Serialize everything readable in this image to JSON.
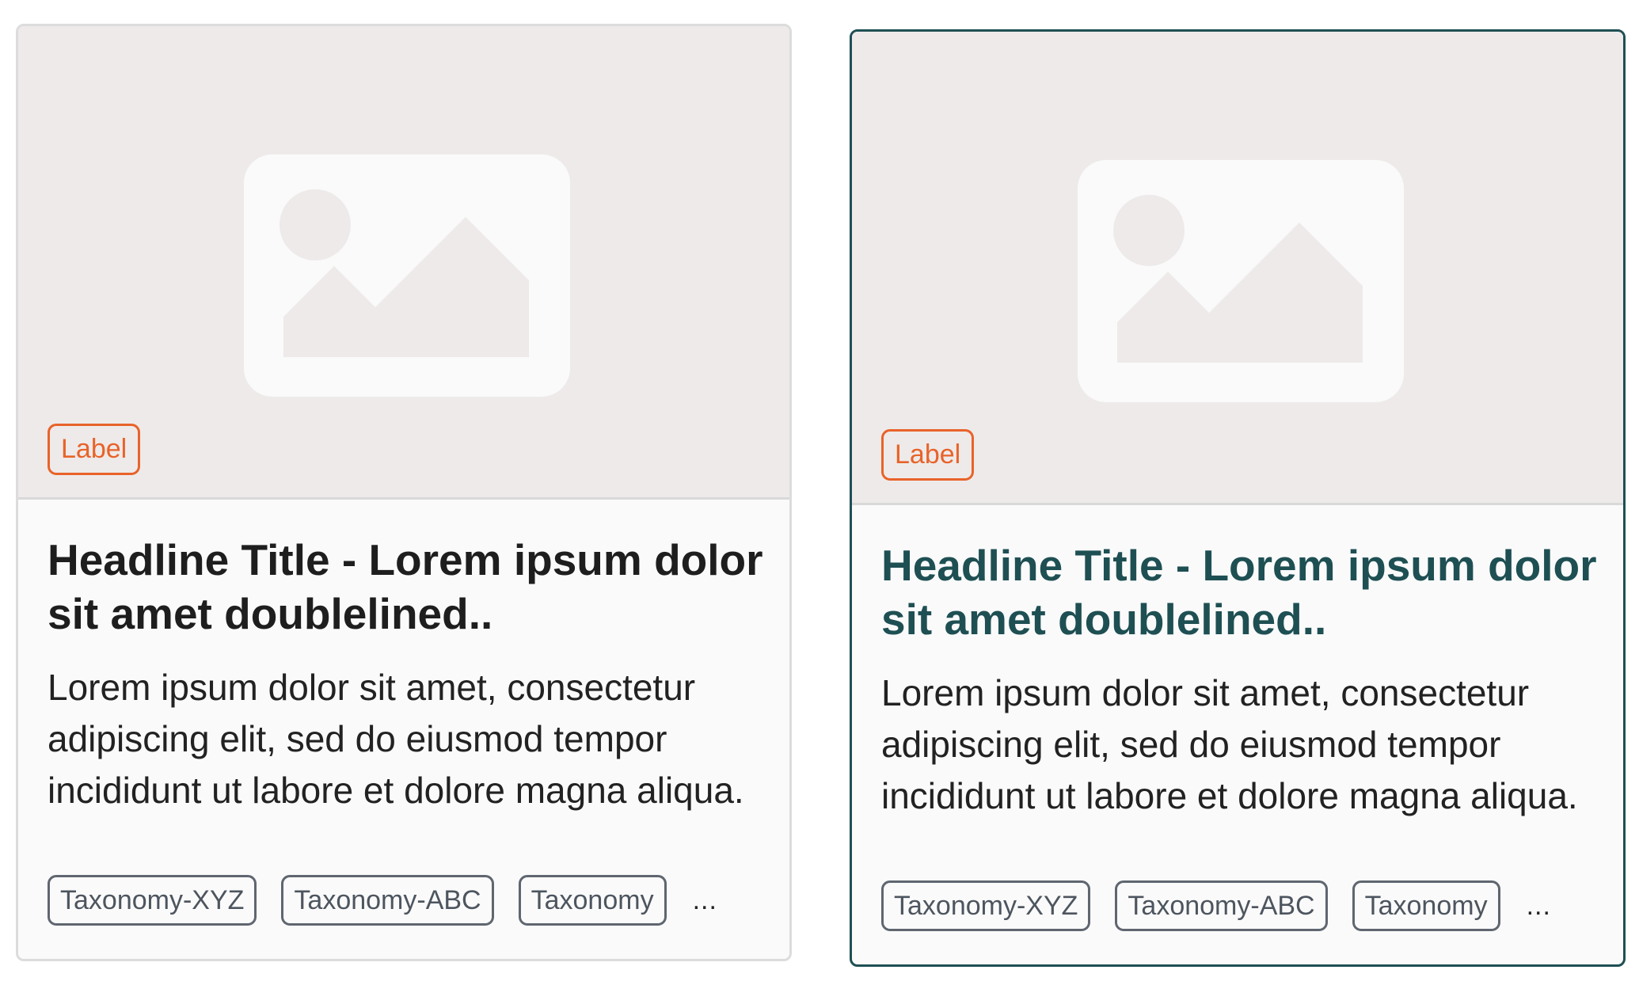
{
  "colors": {
    "label_accent": "#e8632a",
    "selected_border": "#1e4f53",
    "selected_headline": "#1e4f53",
    "media_bg": "#eeeaea"
  },
  "cards": [
    {
      "state": "default",
      "icon": "image-placeholder-icon",
      "label": "Label",
      "headline": "Headline Title - Lorem ipsum dolor sit amet doublelined..",
      "description": "Lorem ipsum dolor sit amet, consectetur adipiscing elit, sed do eiusmod tempor incididunt ut labore et dolore magna aliqua.",
      "tags": [
        "Taxonomy-XYZ",
        "Taxonomy-ABC",
        "Taxonomy"
      ],
      "more": "..."
    },
    {
      "state": "hover",
      "icon": "image-placeholder-icon",
      "label": "Label",
      "headline": "Headline Title - Lorem ipsum dolor sit amet doublelined..",
      "description": "Lorem ipsum dolor sit amet, consectetur adipiscing elit, sed do eiusmod tempor incididunt ut labore et dolore magna aliqua.",
      "tags": [
        "Taxonomy-XYZ",
        "Taxonomy-ABC",
        "Taxonomy"
      ],
      "more": "..."
    }
  ]
}
